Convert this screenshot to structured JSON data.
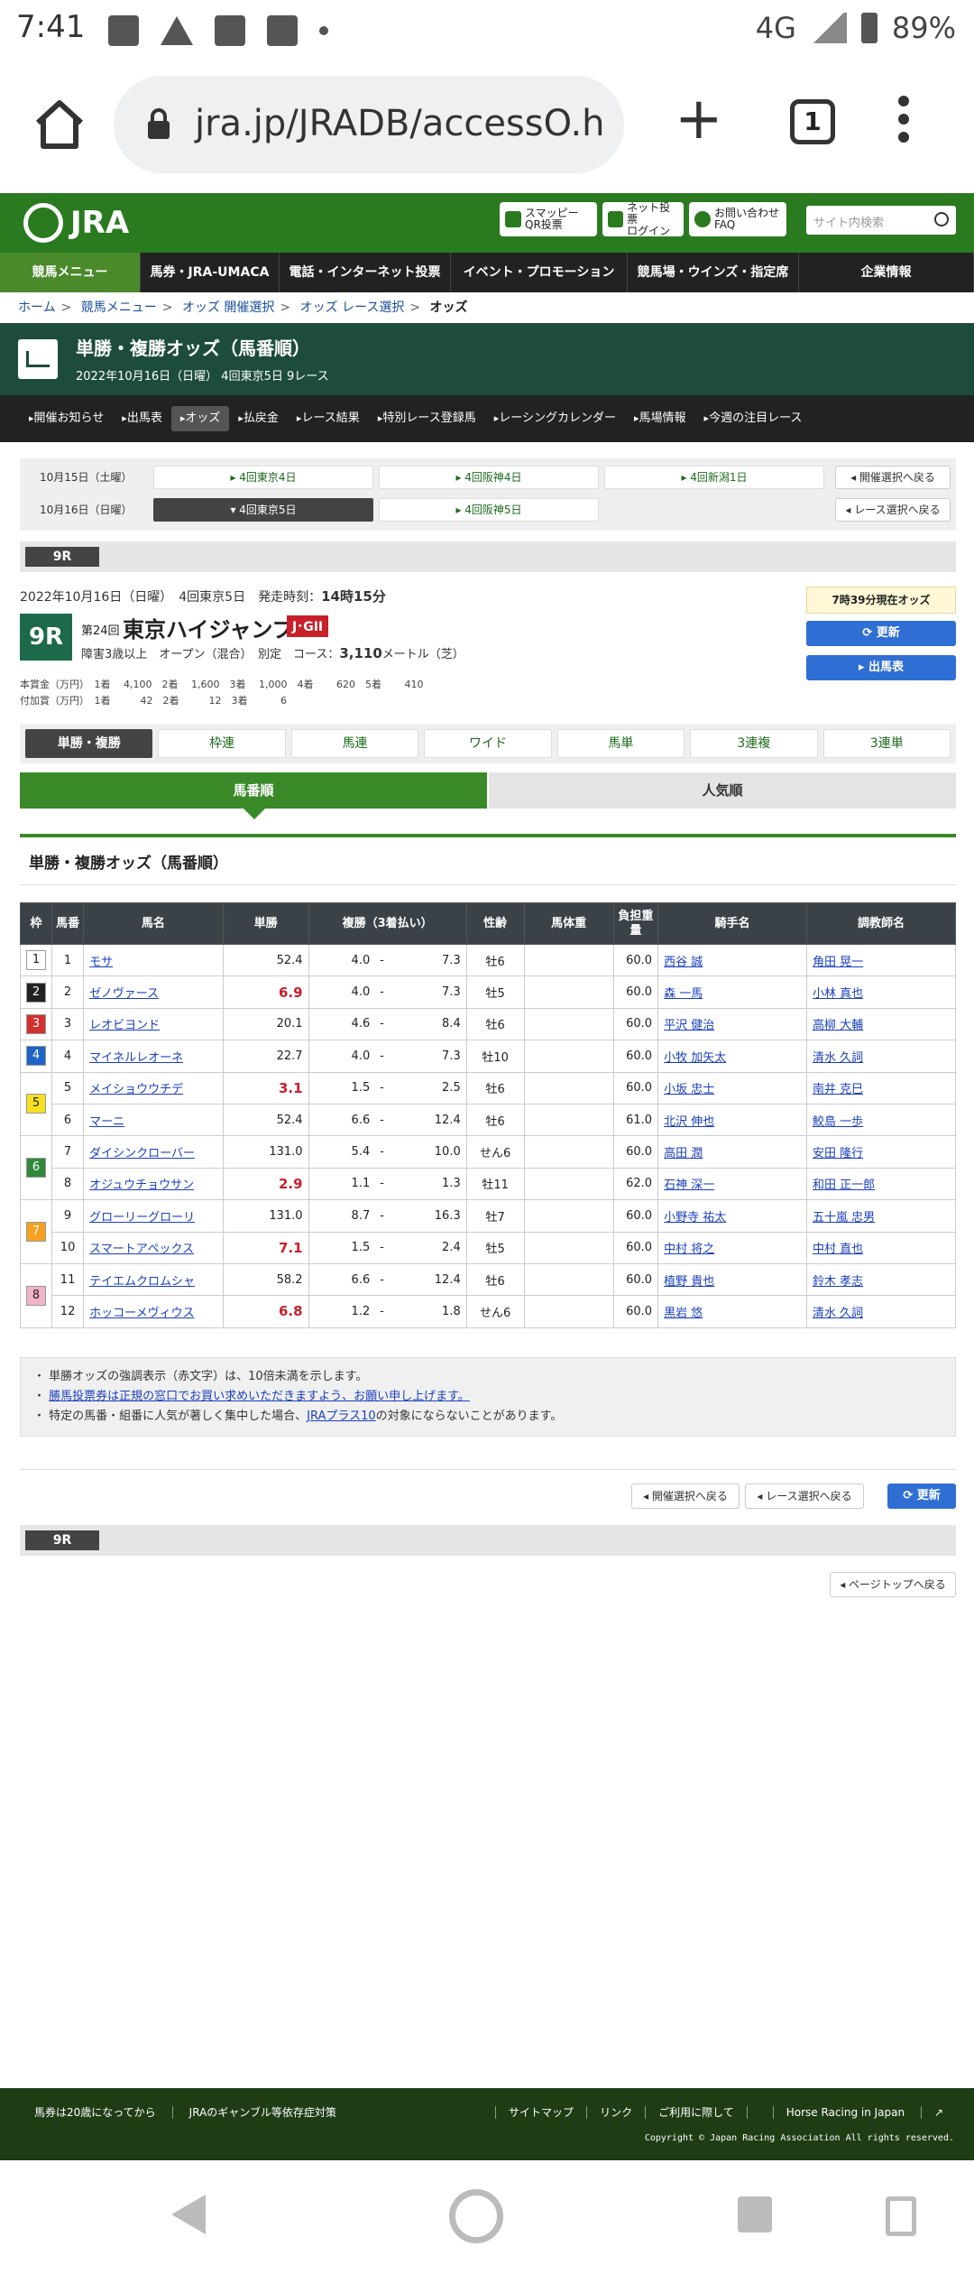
{
  "status_bar": {
    "time": "7:41",
    "network": "4G",
    "battery": "89%"
  },
  "browser": {
    "url": "jra.jp/JRADB/accessO.h",
    "tab_count": "1"
  },
  "site_header": {
    "logo_text": "JRA",
    "smapi_label_1": "スマッピー",
    "smapi_label_2": "QR投票",
    "net_label_1": "ネット投票",
    "net_label_2": "ログイン",
    "faq_label_1": "お問い合わせ",
    "faq_label_2": "FAQ",
    "search_placeholder": "サイト内検索"
  },
  "global_nav": [
    "競馬メニュー",
    "馬券・JRA-UMACA",
    "電話・インターネット投票",
    "イベント・プロモーション",
    "競馬場・ウインズ・指定席",
    "企業情報"
  ],
  "breadcrumb": [
    "ホーム",
    "競馬メニュー",
    "オッズ 開催選択",
    "オッズ レース選択",
    "オッズ"
  ],
  "title": {
    "main": "単勝・複勝オッズ（馬番順）",
    "sub": "2022年10月16日（日曜） 4回東京5日 9レース"
  },
  "sub_nav": [
    "開催お知らせ",
    "出馬表",
    "オッズ",
    "払戻金",
    "レース結果",
    "特別レース登録馬",
    "レーシングカレンダー",
    "馬場情報",
    "今週の注目レース"
  ],
  "date_selector": {
    "rows": [
      {
        "label": "10月15日（土曜）",
        "buttons": [
          "4回東京4日",
          "4回阪神4日",
          "4回新潟1日"
        ]
      },
      {
        "label": "10月16日（日曜）",
        "buttons": [
          "4回東京5日",
          "4回阪神5日"
        ]
      }
    ],
    "back_to_meeting": "開催選択へ戻る",
    "back_to_race": "レース選択へ戻る"
  },
  "race_tab": "9R",
  "race": {
    "date_line": "2022年10月16日（日曜）　4回東京5日　発走時刻：",
    "post_time": "14時15分",
    "race_no": "9R",
    "kai": "第24回",
    "name": "東京ハイジャンプ",
    "grade": "J･GII",
    "cond": "障害3歳以上　オープン（混合）　別定　コース：",
    "distance": "3,110",
    "distance_unit": "メートル（芝）",
    "prize_1": "本賞金（万円）　1着　 4,100　2着　 1,600　3着　 1,000　4着　　 620　5着　　 410",
    "prize_2": "付加賞（万円）　1着　　　42　2着　　　12　3着　　　 6",
    "as_of": "7時39分現在オッズ",
    "update": "更新",
    "entry_table": "出馬表"
  },
  "bet_tabs": [
    "単勝・複勝",
    "枠連",
    "馬連",
    "ワイド",
    "馬単",
    "3連複",
    "3連単"
  ],
  "sort_tabs": {
    "by_number": "馬番順",
    "by_popularity": "人気順"
  },
  "section_title": "単勝・複勝オッズ（馬番順）",
  "table": {
    "headers": [
      "枠",
      "馬番",
      "馬名",
      "単勝",
      "複勝（3着払い）",
      "性齢",
      "馬体重",
      "負担重量",
      "騎手名",
      "調教師名"
    ],
    "rows": [
      {
        "waku": "1",
        "num": "1",
        "horse": "モサ",
        "win": "52.4",
        "pmin": "4.0",
        "pmax": "7.3",
        "sex": "牡6",
        "weight": "",
        "load": "60.0",
        "jockey": "西谷 誠",
        "trainer": "角田 晃一",
        "hl": false
      },
      {
        "waku": "2",
        "num": "2",
        "horse": "ゼノヴァース",
        "win": "6.9",
        "pmin": "4.0",
        "pmax": "7.3",
        "sex": "牡5",
        "weight": "",
        "load": "60.0",
        "jockey": "森 一馬",
        "trainer": "小林 真也",
        "hl": true
      },
      {
        "waku": "3",
        "num": "3",
        "horse": "レオビヨンド",
        "win": "20.1",
        "pmin": "4.6",
        "pmax": "8.4",
        "sex": "牡6",
        "weight": "",
        "load": "60.0",
        "jockey": "平沢 健治",
        "trainer": "高柳 大輔",
        "hl": false
      },
      {
        "waku": "4",
        "num": "4",
        "horse": "マイネルレオーネ",
        "win": "22.7",
        "pmin": "4.0",
        "pmax": "7.3",
        "sex": "牡10",
        "weight": "",
        "load": "60.0",
        "jockey": "小牧 加矢太",
        "trainer": "清水 久詞",
        "hl": false
      },
      {
        "waku": "5",
        "num": "5",
        "horse": "メイショウウチデ",
        "win": "3.1",
        "pmin": "1.5",
        "pmax": "2.5",
        "sex": "牡6",
        "weight": "",
        "load": "60.0",
        "jockey": "小坂 忠士",
        "trainer": "南井 克巳",
        "hl": true
      },
      {
        "waku": "",
        "num": "6",
        "horse": "マーニ",
        "win": "52.4",
        "pmin": "6.6",
        "pmax": "12.4",
        "sex": "牡6",
        "weight": "",
        "load": "61.0",
        "jockey": "北沢 伸也",
        "trainer": "鮫島 一歩",
        "hl": false
      },
      {
        "waku": "6",
        "num": "7",
        "horse": "ダイシンクローバー",
        "win": "131.0",
        "pmin": "5.4",
        "pmax": "10.0",
        "sex": "せん6",
        "weight": "",
        "load": "60.0",
        "jockey": "高田 潤",
        "trainer": "安田 隆行",
        "hl": false
      },
      {
        "waku": "",
        "num": "8",
        "horse": "オジュウチョウサン",
        "win": "2.9",
        "pmin": "1.1",
        "pmax": "1.3",
        "sex": "牡11",
        "weight": "",
        "load": "62.0",
        "jockey": "石神 深一",
        "trainer": "和田 正一郎",
        "hl": true
      },
      {
        "waku": "7",
        "num": "9",
        "horse": "グローリーグローリ",
        "win": "131.0",
        "pmin": "8.7",
        "pmax": "16.3",
        "sex": "牡7",
        "weight": "",
        "load": "60.0",
        "jockey": "小野寺 祐太",
        "trainer": "五十嵐 忠男",
        "hl": false
      },
      {
        "waku": "",
        "num": "10",
        "horse": "スマートアペックス",
        "win": "7.1",
        "pmin": "1.5",
        "pmax": "2.4",
        "sex": "牡5",
        "weight": "",
        "load": "60.0",
        "jockey": "中村 将之",
        "trainer": "中村 直也",
        "hl": true
      },
      {
        "waku": "8",
        "num": "11",
        "horse": "テイエムクロムシャ",
        "win": "58.2",
        "pmin": "6.6",
        "pmax": "12.4",
        "sex": "牡6",
        "weight": "",
        "load": "60.0",
        "jockey": "植野 貴也",
        "trainer": "鈴木 孝志",
        "hl": false
      },
      {
        "waku": "",
        "num": "12",
        "horse": "ホッコーメヴィウス",
        "win": "6.8",
        "pmin": "1.2",
        "pmax": "1.8",
        "sex": "せん6",
        "weight": "",
        "load": "60.0",
        "jockey": "黒岩 悠",
        "trainer": "清水 久詞",
        "hl": true
      }
    ]
  },
  "notes": {
    "n1": "単勝オッズの強調表示（赤文字）は、10倍未満を示します。",
    "n2": "勝馬投票券は正規の窓口でお買い求めいただきますよう、お願い申し上げます。",
    "n3_pre": "特定の馬番・組番に人気が著しく集中した場合、",
    "n3_link": "JRAプラス10",
    "n3_post": "の対象にならないことがあります。"
  },
  "bottom_buttons": {
    "back_meeting": "開催選択へ戻る",
    "back_race": "レース選択へ戻る",
    "update": "更新"
  },
  "race_tab_bottom": "9R",
  "page_top": "ページトップへ戻る",
  "footer": {
    "left": [
      "馬券は20歳になってから",
      "JRAのギャンブル等依存症対策"
    ],
    "right": [
      "サイトマップ",
      "リンク",
      "ご利用に際して",
      "Horse Racing in Japan"
    ],
    "copyright": "Copyright © Japan Racing Association All rights reserved."
  }
}
